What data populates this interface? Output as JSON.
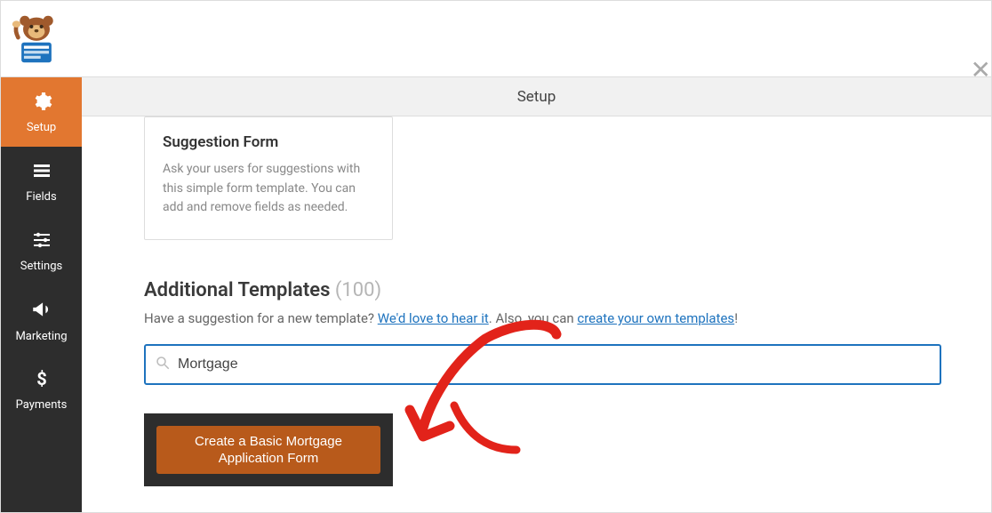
{
  "header": {
    "page_title": "Setup"
  },
  "sidebar": {
    "items": [
      {
        "label": "Setup"
      },
      {
        "label": "Fields"
      },
      {
        "label": "Settings"
      },
      {
        "label": "Marketing"
      },
      {
        "label": "Payments"
      }
    ]
  },
  "suggestion_card": {
    "title": "Suggestion Form",
    "desc": "Ask your users for suggestions with this simple form template. You can add and remove fields as needed."
  },
  "templates": {
    "heading": "Additional Templates",
    "count": "(100)",
    "prompt_prefix": "Have a suggestion for a new template? ",
    "link1": "We'd love to hear it",
    "prompt_mid": ". Also, you can ",
    "link2": "create your own templates",
    "prompt_suffix": "!"
  },
  "search": {
    "value": "Mortgage",
    "placeholder": ""
  },
  "result": {
    "button_label": "Create a Basic Mortgage Application Form"
  }
}
